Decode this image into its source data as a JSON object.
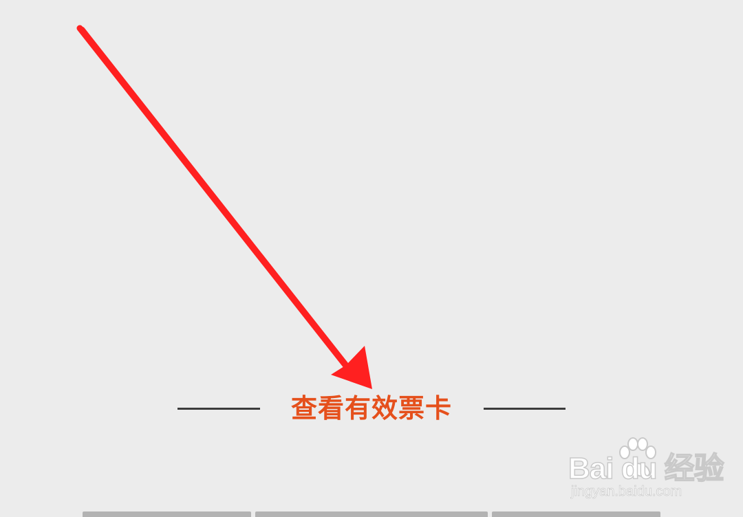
{
  "section": {
    "link_label": "查看有效票卡"
  },
  "watermark": {
    "logo_text": "Bai du 经验",
    "url": "jingyan.baidu.com"
  },
  "annotation": {
    "arrow_color": "#ff2020"
  },
  "colors": {
    "background": "#ececec",
    "link": "#e5501c",
    "divider": "#3b3b3b",
    "tab_strip": "#b3b3b3"
  },
  "bottom_tabs": [
    {
      "icon": "tab-strip"
    },
    {
      "icon": "tab-strip"
    },
    {
      "icon": "tab-strip"
    }
  ]
}
